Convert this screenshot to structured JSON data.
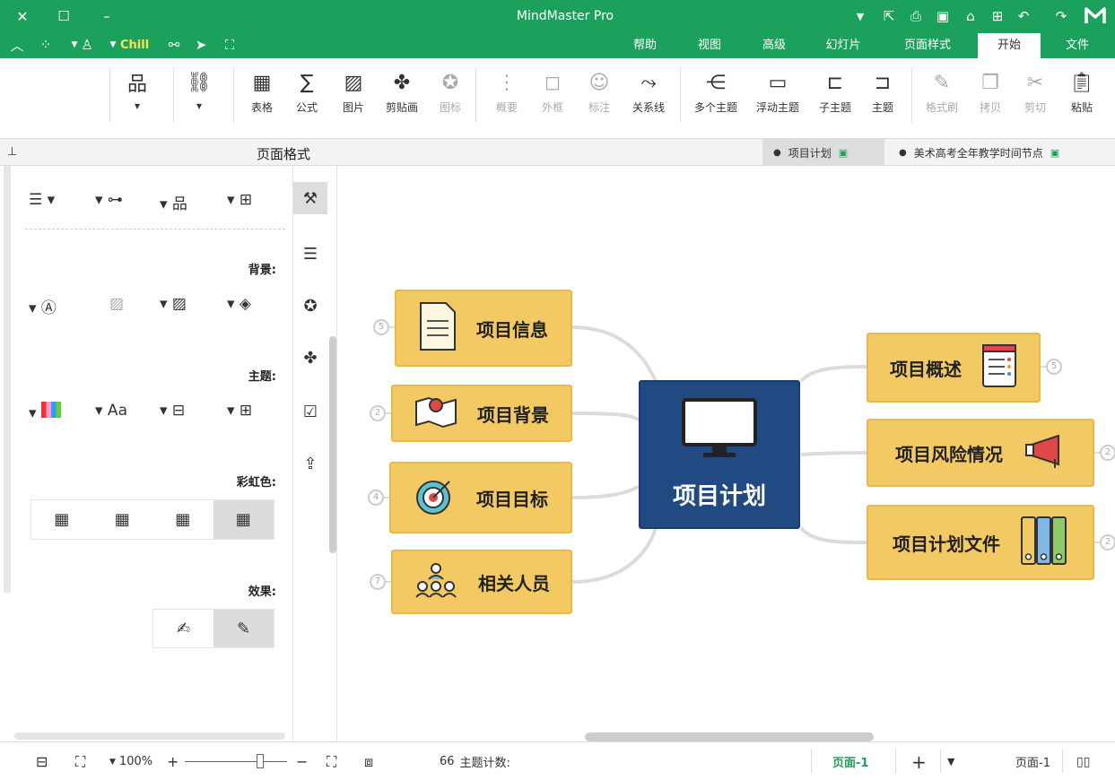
{
  "window": {
    "title": "MindMaster Pro",
    "theme": "Chill"
  },
  "tabs": [
    "文件",
    "开始",
    "页面样式",
    "幻灯片",
    "高级",
    "视图",
    "帮助"
  ],
  "active_tab": "开始",
  "ribbon": {
    "paste": "粘贴",
    "cut": "剪切",
    "copy": "拷贝",
    "format_painter": "格式刷",
    "topic": "主题",
    "subtopic": "子主题",
    "floating_topic": "浮动主题",
    "multiple_topics": "多个主题",
    "relationship": "关系线",
    "callout": "标注",
    "boundary": "外框",
    "summary": "概要",
    "icon": "图标",
    "clipart": "剪贴画",
    "picture": "图片",
    "formula": "公式",
    "table": "表格"
  },
  "doc_tabs": [
    {
      "label": "美术高考全年教学时间节点",
      "active": false
    },
    {
      "label": "项目计划",
      "active": true
    }
  ],
  "panel": {
    "title": "页面格式",
    "background_label": "背景:",
    "theme_label": "主题:",
    "rainbow_label": "彩虹色:",
    "effect_label": "效果:"
  },
  "mindmap": {
    "central": "项目计划",
    "right_topics": [
      {
        "label": "项目概述",
        "count": "5"
      },
      {
        "label": "项目风险情况",
        "count": "2"
      },
      {
        "label": "项目计划文件",
        "count": "2"
      }
    ],
    "left_topics": [
      {
        "label": "项目信息",
        "count": "5"
      },
      {
        "label": "项目背景",
        "count": "2"
      },
      {
        "label": "项目目标",
        "count": "4"
      },
      {
        "label": "相关人员",
        "count": "7"
      }
    ]
  },
  "status": {
    "page_tab": "页面-1",
    "page_current": "页面-1",
    "topic_count_label": "主题计数:",
    "topic_count": "66",
    "zoom": "100%"
  },
  "colors": {
    "brand": "#1ca15c",
    "central": "#224a82",
    "topic": "#f3c964",
    "topic_border": "#e7b84a"
  }
}
